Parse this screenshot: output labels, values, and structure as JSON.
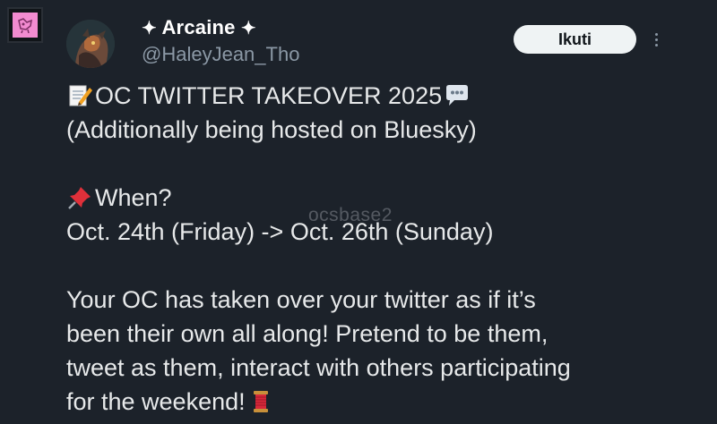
{
  "profile": {
    "display_name": "Arcaine",
    "name_ornament_left": "✦",
    "name_ornament_right": "✦",
    "handle": "@HaleyJean_Tho"
  },
  "header": {
    "follow_label": "Ikuti",
    "more_icon": "more-vertical-icon"
  },
  "tweet": {
    "line1_text": "OC TWITTER TAKEOVER 2025",
    "line1_icon_left": "memo-emoji",
    "line1_icon_right": "speech-bubble-emoji",
    "line2": "(Additionally being hosted on Bluesky)",
    "line3_icon": "pushpin-emoji",
    "line3_text": "When?",
    "line4": "Oct. 24th (Friday) -> Oct. 26th (Sunday)",
    "line5": "Your OC has taken over your twitter as if it’s",
    "line6": "been their own all along! Pretend to be them,",
    "line7": "tweet as them, interact with others participating",
    "line8": "for the weekend!",
    "line8_icon": "spool-of-thread-emoji"
  },
  "watermark": "ocsbase2",
  "colors": {
    "background": "#1c222a",
    "text": "#e7e9ea",
    "secondary_text": "#8b98a5",
    "button_bg": "#eff3f4",
    "badge_pink": "#f28bd0"
  }
}
